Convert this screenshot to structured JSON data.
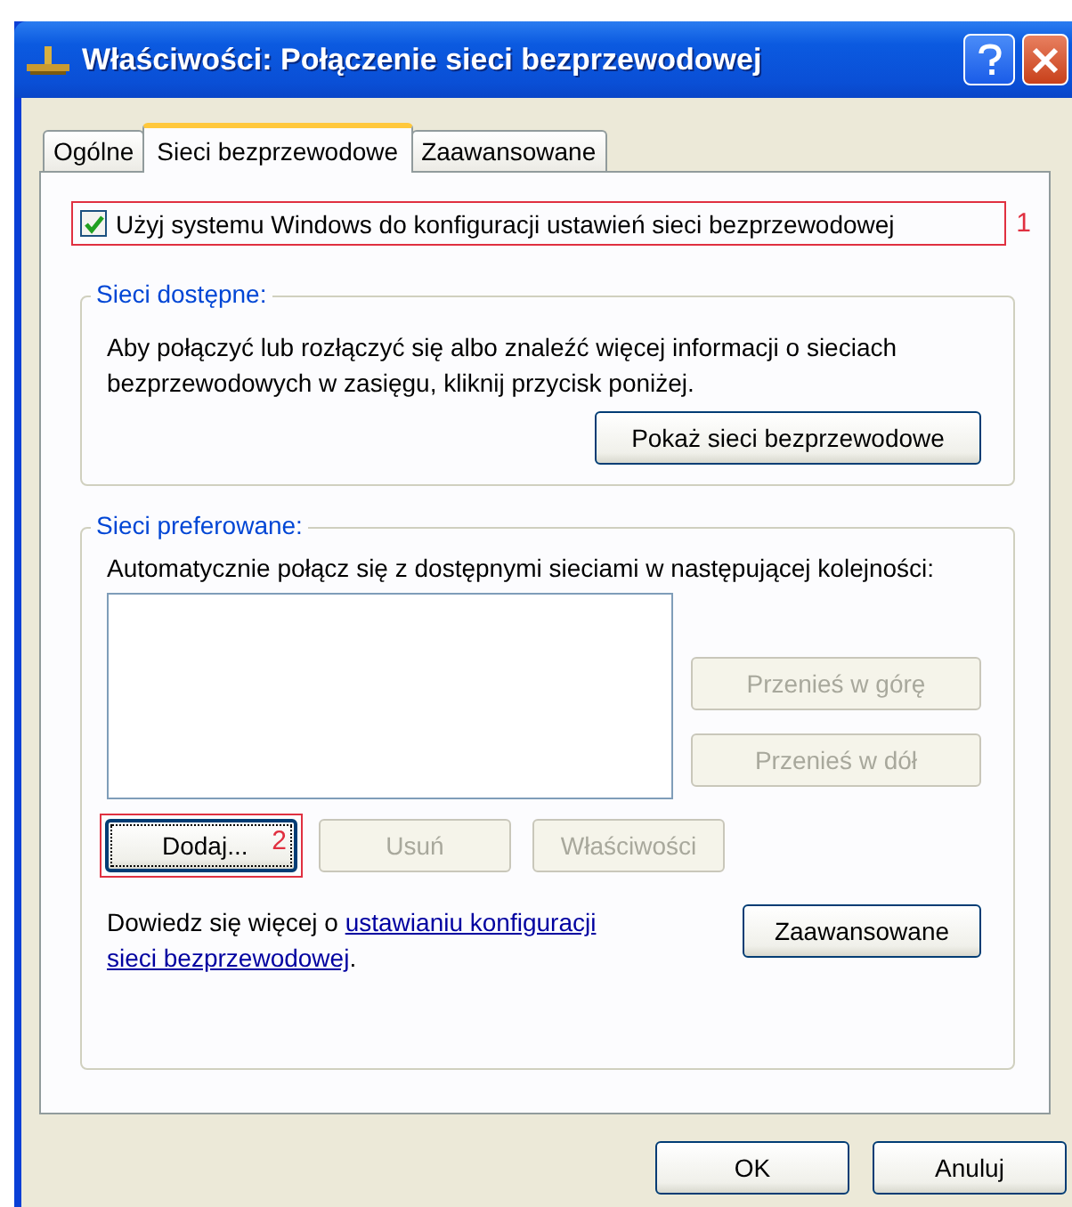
{
  "window": {
    "title": "Właściwości: Połączenie sieci bezprzewodowej"
  },
  "tabs": [
    {
      "label": "Ogólne",
      "selected": false
    },
    {
      "label": "Sieci bezprzewodowe",
      "selected": true
    },
    {
      "label": "Zaawansowane",
      "selected": false
    }
  ],
  "use_windows": {
    "label": "Użyj systemu Windows do konfiguracji ustawień sieci bezprzewodowej",
    "checked": true,
    "annotation": "1"
  },
  "available": {
    "title": "Sieci dostępne:",
    "text": "Aby połączyć lub rozłączyć się albo znaleźć więcej informacji o sieciach bezprzewodowych w zasięgu, kliknij przycisk poniżej.",
    "button": {
      "label": "Pokaż sieci bezprzewodowe",
      "disabled": false
    }
  },
  "preferred": {
    "title": "Sieci preferowane:",
    "text": "Automatycznie połącz się z dostępnymi sieciami w następującej kolejności:",
    "side_buttons": [
      {
        "label": "Przenieś w górę",
        "disabled": true
      },
      {
        "label": "Przenieś w dół",
        "disabled": true
      }
    ],
    "bottom_buttons": [
      {
        "label": "Dodaj...",
        "disabled": false,
        "focused": true,
        "annotation": "2"
      },
      {
        "label": "Usuń",
        "disabled": true,
        "focused": false
      },
      {
        "label": "Właściwości",
        "disabled": true,
        "focused": false
      }
    ],
    "learn_more": {
      "prefix": "Dowiedz się więcej o ",
      "link_lines": [
        "ustawianiu konfiguracji",
        "sieci bezprzewodowej"
      ],
      "suffix": "."
    },
    "advanced_button": {
      "label": "Zaawansowane",
      "disabled": false
    }
  },
  "footer_buttons": [
    {
      "label": "OK",
      "disabled": false
    },
    {
      "label": "Anuluj",
      "disabled": false
    }
  ]
}
